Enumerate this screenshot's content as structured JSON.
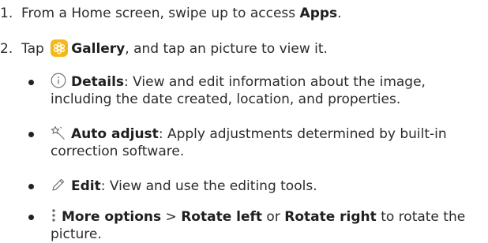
{
  "step1": {
    "number": "1.",
    "text_before": "From a Home screen, swipe up to access ",
    "apps": "Apps",
    "text_after": "."
  },
  "step2": {
    "number": "2.",
    "tap": "Tap",
    "gallery": "Gallery",
    "text_after": ", and tap an picture to view it."
  },
  "bullets": {
    "details": {
      "icon": "info-icon",
      "title": "Details",
      "line1": ": View and edit information about the image,",
      "line2": "including the date created, location, and properties."
    },
    "auto_adjust": {
      "icon": "magic-wand-icon",
      "title": "Auto adjust",
      "line1": ": Apply adjustments determined by built-in",
      "line2": "correction software."
    },
    "edit": {
      "icon": "pencil-icon",
      "title": "Edit",
      "line1": ": View and use the editing tools."
    },
    "more": {
      "icon": "more-options-icon",
      "title": "More options",
      "separator": " > ",
      "rotate_left": "Rotate left",
      "or": " or ",
      "rotate_right": "Rotate right",
      "line1_tail": " to rotate the",
      "line2": "picture."
    }
  },
  "colors": {
    "gallery_icon": "#f5b816",
    "text": "#2b2b2b"
  }
}
